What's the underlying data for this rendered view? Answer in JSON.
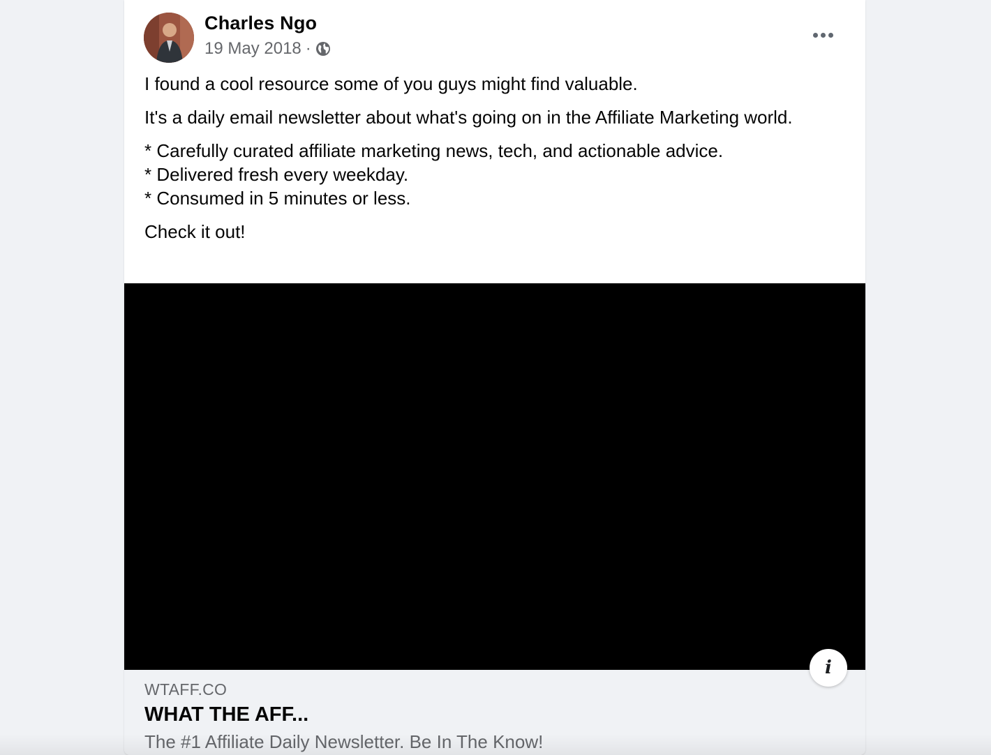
{
  "post": {
    "author": "Charles Ngo",
    "date": "19 May 2018",
    "separator": "·",
    "privacy_icon": "globe-icon",
    "more_icon": "more-options-icon",
    "paragraphs": [
      "I found a cool resource some of you guys might find valuable.",
      "It's a daily email newsletter about what's going on in the Affiliate Marketing world."
    ],
    "bullets": [
      "* Carefully curated affiliate marketing news, tech, and actionable advice.",
      "* Delivered fresh every weekday.",
      "* Consumed in 5 minutes or less."
    ],
    "closing": "Check it out!"
  },
  "link_preview": {
    "domain": "WTAFF.CO",
    "title": "WHAT THE AFF...",
    "description": "The #1 Affiliate Daily Newsletter. Be In The Know!",
    "info_icon": "info-icon",
    "info_label": "i"
  },
  "colors": {
    "background": "#f0f2f5",
    "card": "#ffffff",
    "secondary_text": "#65676b",
    "media": "#000000"
  }
}
